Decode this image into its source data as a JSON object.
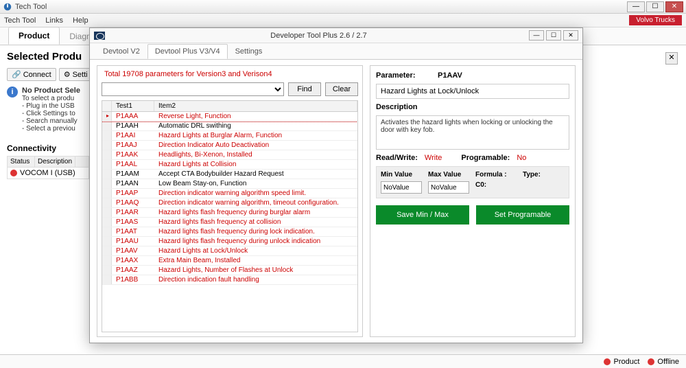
{
  "titlebar": {
    "title": "Tech Tool"
  },
  "menubar": {
    "items": [
      "Tech Tool",
      "Links",
      "Help"
    ],
    "brand": "Volvo Trucks"
  },
  "maintabs": {
    "product": "Product",
    "diagnose": "Diagnose"
  },
  "leftcol": {
    "heading": "Selected Produ",
    "connect": "Connect",
    "settings": "Setti",
    "info_title": "No Product Sele",
    "info_lines": [
      "To select a produ",
      "- Plug in the USB",
      "- Click Settings to",
      "- Search manually",
      "- Select a previou"
    ],
    "connectivity": "Connectivity",
    "th_status": "Status",
    "th_desc": "Description",
    "vocom": "VOCOM I (USB)"
  },
  "modal": {
    "title": "Developer Tool Plus 2.6 / 2.7",
    "tabs": {
      "v2": "Devtool V2",
      "v34": "Devtool Plus V3/V4",
      "settings": "Settings"
    },
    "total": "Total 19708 parameters for Version3 and Verison4",
    "find": "Find",
    "clear": "Clear",
    "grid_h1": "Test1",
    "grid_h2": "Item2",
    "rows": [
      {
        "id": "P1AAA",
        "desc": "Reverse Light, Function",
        "red": true,
        "sel": true
      },
      {
        "id": "P1AAH",
        "desc": "Automatic DRL swithing",
        "red": false
      },
      {
        "id": "P1AAI",
        "desc": "Hazard Lights at Burglar Alarm, Function",
        "red": true
      },
      {
        "id": "P1AAJ",
        "desc": "Direction Indicator Auto Deactivation",
        "red": true
      },
      {
        "id": "P1AAK",
        "desc": "Headlights, Bi-Xenon, Installed",
        "red": true
      },
      {
        "id": "P1AAL",
        "desc": "Hazard Lights at Collision",
        "red": true
      },
      {
        "id": "P1AAM",
        "desc": "Accept CTA Bodybuilder Hazard Request",
        "red": false
      },
      {
        "id": "P1AAN",
        "desc": "Low Beam Stay-on, Function",
        "red": false
      },
      {
        "id": "P1AAP",
        "desc": "Direction indicator warning algorithm speed limit.",
        "red": true
      },
      {
        "id": "P1AAQ",
        "desc": "Direction indicator warning algorithm, timeout configuration.",
        "red": true
      },
      {
        "id": "P1AAR",
        "desc": "Hazard lights flash frequency during burglar alarm",
        "red": true
      },
      {
        "id": "P1AAS",
        "desc": "Hazard lights flash frequency at collision",
        "red": true
      },
      {
        "id": "P1AAT",
        "desc": "Hazard lights flash frequency during lock indication.",
        "red": true
      },
      {
        "id": "P1AAU",
        "desc": "Hazard lights flash frequency during unlock indication",
        "red": true
      },
      {
        "id": "P1AAV",
        "desc": "Hazard Lights at Lock/Unlock",
        "red": true
      },
      {
        "id": "P1AAX",
        "desc": "Extra Main Beam, Installed",
        "red": true
      },
      {
        "id": "P1AAZ",
        "desc": "Hazard Lights, Number of Flashes at Unlock",
        "red": true
      },
      {
        "id": "P1ABB",
        "desc": "Direction indication fault handling",
        "red": true
      }
    ]
  },
  "detail": {
    "param_lbl": "Parameter:",
    "param_val": "P1AAV",
    "name": "Hazard Lights at Lock/Unlock",
    "desc_lbl": "Description",
    "desc_txt": "Activates the hazard lights when locking or unlocking the door with key fob.",
    "rw_lbl": "Read/Write:",
    "rw_val": "Write",
    "prog_lbl": "Programable:",
    "prog_val": "No",
    "min_lbl": "Min Value",
    "max_lbl": "Max Value",
    "formula_lbl": "Formula :",
    "type_lbl": "Type:",
    "min_val": "NoValue",
    "max_val": "NoValue",
    "c0": "C0:",
    "save_btn": "Save Min / Max",
    "setprog_btn": "Set Programable"
  },
  "statusbar": {
    "product": "Product",
    "offline": "Offline"
  }
}
